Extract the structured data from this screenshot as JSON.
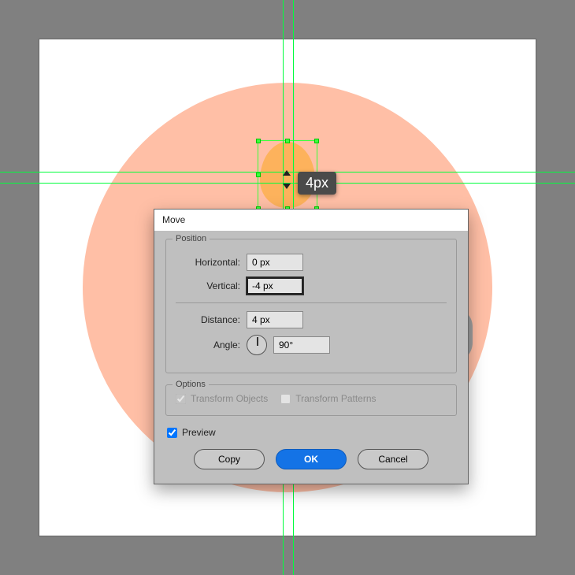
{
  "guides": {
    "h1": 218,
    "h2": 232,
    "v1": 359,
    "v2": 372
  },
  "tooltip": "4px",
  "dialog": {
    "title": "Move",
    "position_legend": "Position",
    "horizontal_label": "Horizontal:",
    "horizontal_value": "0 px",
    "vertical_label": "Vertical:",
    "vertical_value": "-4 px",
    "distance_label": "Distance:",
    "distance_value": "4 px",
    "angle_label": "Angle:",
    "angle_value": "90°",
    "options_legend": "Options",
    "transform_objects_label": "Transform Objects",
    "transform_objects_checked": true,
    "transform_patterns_label": "Transform Patterns",
    "transform_patterns_checked": false,
    "preview_label": "Preview",
    "preview_checked": true,
    "copy_label": "Copy",
    "ok_label": "OK",
    "cancel_label": "Cancel"
  }
}
